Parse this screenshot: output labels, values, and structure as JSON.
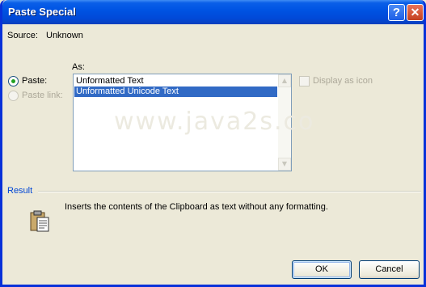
{
  "window": {
    "title": "Paste Special",
    "help_glyph": "?",
    "close_glyph": "✕"
  },
  "source": {
    "label": "Source:",
    "value": "Unknown"
  },
  "as_label": "As:",
  "options": {
    "paste": {
      "label": "Paste:",
      "selected": true
    },
    "paste_link": {
      "label": "Paste link:",
      "enabled": false
    }
  },
  "formats": [
    {
      "label": "Unformatted Text",
      "selected": false
    },
    {
      "label": "Unformatted Unicode Text",
      "selected": true
    }
  ],
  "display_as_icon": {
    "label": "Display as icon",
    "checked": false,
    "enabled": false
  },
  "watermark": "www.java2s.co",
  "result": {
    "label": "Result",
    "text": "Inserts the contents of the Clipboard as text without any formatting.",
    "icon": "clipboard-icon"
  },
  "buttons": {
    "ok": "OK",
    "cancel": "Cancel"
  },
  "colors": {
    "title_bar": "#0054e3",
    "selection": "#316ac5",
    "result_label": "#0046d5",
    "dialog_bg": "#ece9d8"
  }
}
